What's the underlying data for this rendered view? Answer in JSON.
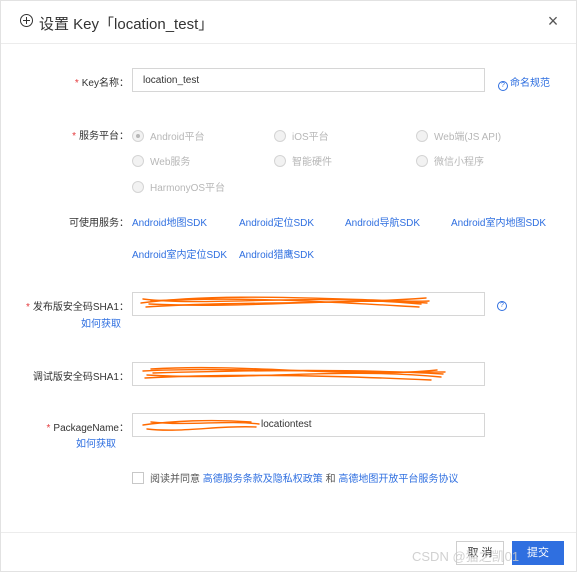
{
  "dialog": {
    "title": "设置 Key「location_test」",
    "close_glyph": "×"
  },
  "fields": {
    "key_name": {
      "label": "Key名称：",
      "value": "location_test",
      "help": "命名规范"
    },
    "platform": {
      "label": "服务平台：",
      "options": [
        {
          "label": "Android平台",
          "checked": true
        },
        {
          "label": "iOS平台",
          "checked": false
        },
        {
          "label": "Web端(JS API)",
          "checked": false
        },
        {
          "label": "Web服务",
          "checked": false
        },
        {
          "label": "智能硬件",
          "checked": false
        },
        {
          "label": "微信小程序",
          "checked": false
        },
        {
          "label": "HarmonyOS平台",
          "checked": false
        }
      ]
    },
    "services": {
      "label": "可使用服务：",
      "items": [
        "Android地图SDK",
        "Android定位SDK",
        "Android导航SDK",
        "Android室内地图SDK",
        "Android室内定位SDK",
        "Android猎鹰SDK"
      ]
    },
    "release_sha1": {
      "label": "发布版安全码SHA1：",
      "link": "如何获取",
      "value": ""
    },
    "debug_sha1": {
      "label": "调试版安全码SHA1：",
      "value": ""
    },
    "package": {
      "label": "PackageName：",
      "link": "如何获取",
      "value": "com.example.locationtest",
      "visible_suffix": "locationtest"
    }
  },
  "agreement": {
    "prefix": "阅读并同意",
    "link1": "高德服务条款及隐私权政策",
    "and": "和",
    "link2": "高德地图开放平台服务协议"
  },
  "buttons": {
    "cancel": "取 消",
    "submit": "提交"
  },
  "watermark": "CSDN @猫之凯01",
  "colors": {
    "accent": "#2f6fe0",
    "required": "#e4393c",
    "redaction": "#ff6a00"
  },
  "icons": [
    "plus-circle-icon",
    "close-icon",
    "question-icon",
    "checkbox-icon"
  ]
}
